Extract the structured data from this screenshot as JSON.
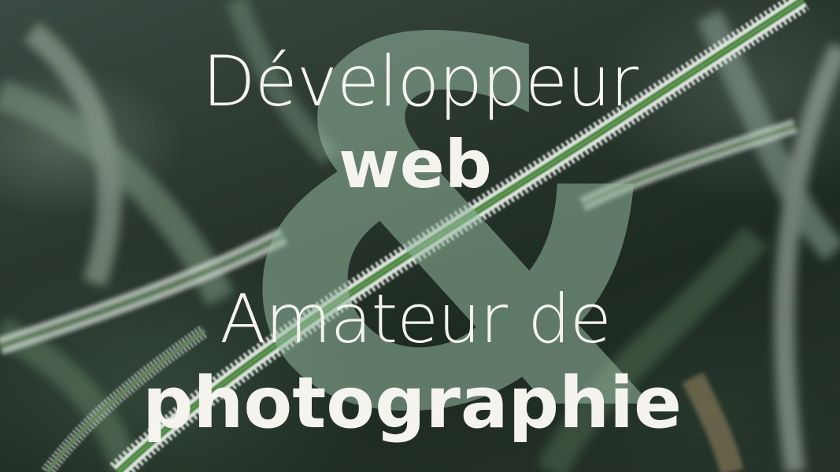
{
  "hero": {
    "line1": "Développeur",
    "line2": "web",
    "ampersand": "&",
    "line3": "Amateur de",
    "line4": "photographie"
  },
  "background": {
    "subject": "frost-covered-grass-photo",
    "colors": {
      "text": "#f5f3ee",
      "ampersand": "#96b9a0",
      "grass_green": "#3f7a3a",
      "frost": "#e8ece8",
      "dark_bg": "#1f2a22"
    }
  }
}
